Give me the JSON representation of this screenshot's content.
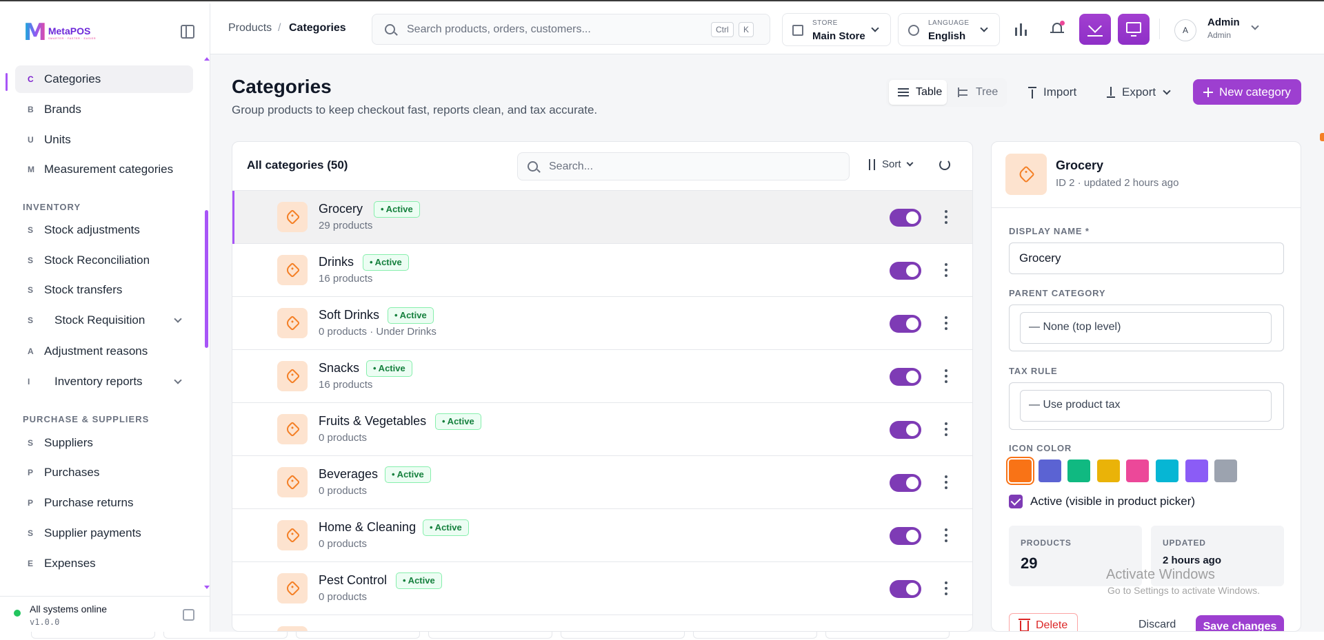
{
  "app": {
    "logo_name": "MetaPOS",
    "logo_tagline": "SMARTER · FASTER · EASIER"
  },
  "sidebar": {
    "items_top": [
      {
        "letter": "C",
        "label": "Categories"
      },
      {
        "letter": "B",
        "label": "Brands"
      },
      {
        "letter": "U",
        "label": "Units"
      },
      {
        "letter": "M",
        "label": "Measurement categories"
      }
    ],
    "section_inventory": "INVENTORY",
    "items_inventory": [
      {
        "letter": "S",
        "label": "Stock adjustments"
      },
      {
        "letter": "S",
        "label": "Stock Reconciliation"
      },
      {
        "letter": "S",
        "label": "Stock transfers"
      },
      {
        "letter": "S",
        "label": "Stock Requisition"
      },
      {
        "letter": "A",
        "label": "Adjustment reasons"
      },
      {
        "letter": "I",
        "label": "Inventory reports"
      }
    ],
    "section_purchase": "PURCHASE & SUPPLIERS",
    "items_purchase": [
      {
        "letter": "S",
        "label": "Suppliers"
      },
      {
        "letter": "P",
        "label": "Purchases"
      },
      {
        "letter": "P",
        "label": "Purchase returns"
      },
      {
        "letter": "S",
        "label": "Supplier payments"
      },
      {
        "letter": "E",
        "label": "Expenses"
      }
    ],
    "footer": {
      "status": "All systems online",
      "version": "v1.0.0"
    }
  },
  "header": {
    "breadcrumb": [
      "Products",
      "/",
      "Categories"
    ],
    "search_placeholder": "Search products, orders, customers...",
    "shortcut": [
      "Ctrl",
      "K"
    ],
    "store": {
      "caption": "STORE",
      "value": "Main Store"
    },
    "language": {
      "caption": "LANGUAGE",
      "value": "English"
    },
    "user": {
      "initial": "A",
      "name": "Admin",
      "role": "Admin"
    }
  },
  "page": {
    "title": "Categories",
    "subtitle": "Group products to keep checkout fast, reports clean, and tax accurate.",
    "view_table": "Table",
    "view_tree": "Tree",
    "import": "Import",
    "export": "Export",
    "new": "New category"
  },
  "list": {
    "title": "All categories (50)",
    "search_placeholder": "Search...",
    "sort": "Sort",
    "rows": [
      {
        "name": "Grocery",
        "status": "• Active",
        "meta": "29 products"
      },
      {
        "name": "Drinks",
        "status": "• Active",
        "meta": "16 products"
      },
      {
        "name": "Soft Drinks",
        "status": "• Active",
        "meta": "0 products  ·  Under Drinks"
      },
      {
        "name": "Snacks",
        "status": "• Active",
        "meta": "16 products"
      },
      {
        "name": "Fruits & Vegetables",
        "status": "• Active",
        "meta": "0 products"
      },
      {
        "name": "Beverages",
        "status": "• Active",
        "meta": "0 products"
      },
      {
        "name": "Home & Cleaning",
        "status": "• Active",
        "meta": "0 products"
      },
      {
        "name": "Pest Control",
        "status": "• Active",
        "meta": "0 products"
      }
    ]
  },
  "detail": {
    "name": "Grocery",
    "meta": "ID 2 · updated 2 hours ago",
    "display_name_label": "DISPLAY NAME *",
    "display_name_value": "Grocery",
    "parent_label": "PARENT CATEGORY",
    "parent_value": "— None (top level)",
    "tax_label": "TAX RULE",
    "tax_value": "— Use product tax",
    "icon_color_label": "ICON COLOR",
    "colors": [
      "#f97316",
      "#5b63d3",
      "#10b981",
      "#eab308",
      "#ec4899",
      "#06b6d4",
      "#8b5cf6",
      "#9ca3af"
    ],
    "active_label": "Active (visible in product picker)",
    "stat_products_label": "PRODUCTS",
    "stat_products_value": "29",
    "stat_updated_label": "UPDATED",
    "stat_updated_value": "2 hours ago",
    "delete": "Delete",
    "discard": "Discard",
    "save": "Save changes"
  },
  "watermark": {
    "title": "Activate Windows",
    "sub": "Go to Settings to activate Windows."
  }
}
